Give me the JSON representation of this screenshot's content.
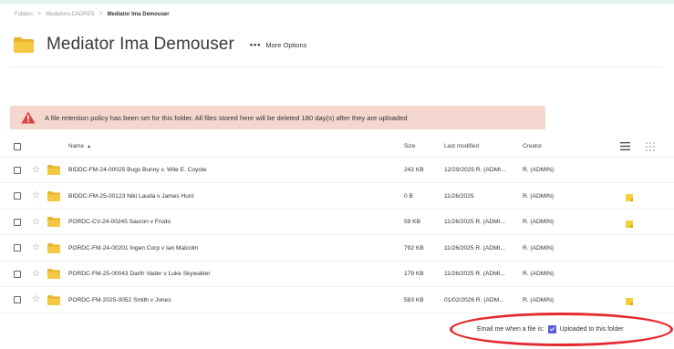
{
  "breadcrumb": {
    "items": [
      "Folders",
      "Mediators-CADRES",
      "Mediator Ima Demouser"
    ],
    "separator": ">"
  },
  "header": {
    "title": "Mediator Ima Demouser",
    "more_dots": "•••",
    "more_label": "More Options"
  },
  "banner": {
    "message": "A file retention policy has been set for this folder. All files stored here will be deleted 180 day(s) after they are uploaded",
    "color": "#f4d7cf",
    "icon": "warning-triangle-icon"
  },
  "table": {
    "columns": {
      "name": "Name",
      "sort_indicator": "▲",
      "size": "Size",
      "modified": "Last modified",
      "creator": "Creator"
    },
    "rows": [
      {
        "name": "BIDDC-FM-24-00025 Bugs Bunny v. Wile E. Coyote",
        "size": "242 KB",
        "modified": "12/29/2025 R. (ADMI...",
        "creator": "R. (ADMIN)",
        "note": false
      },
      {
        "name": "BIDDC-FM-25-00123 Niki Lauda v James Hunt",
        "size": "0 B",
        "modified": "11/26/2025",
        "creator": "R. (ADMIN)",
        "note": true
      },
      {
        "name": "PORDC-CV-24-00245 Sauron v Frodo",
        "size": "59 KB",
        "modified": "11/26/2025 R. (ADMI...",
        "creator": "R. (ADMIN)",
        "note": true
      },
      {
        "name": "PORDC-FM-24-00201 Ingen Corp v Ian Malcolm",
        "size": "792 KB",
        "modified": "11/26/2025 R. (ADMI...",
        "creator": "R. (ADMIN)",
        "note": false
      },
      {
        "name": "PORDC-FM-25-00043 Darth Vader v Luke Skywalker",
        "size": "179 KB",
        "modified": "11/26/2025 R. (ADMI...",
        "creator": "R. (ADMIN)",
        "note": false
      },
      {
        "name": "PORDC-FM-2025-0052 Smith v Jones",
        "size": "583 KB",
        "modified": "01/02/2026 R. (ADM...",
        "creator": "R. (ADMIN)",
        "note": true
      }
    ]
  },
  "email_notify": {
    "label": "Email me when a file is:",
    "option": "Uploaded to this folder",
    "checked": true
  },
  "colors": {
    "accent_check": "#5a5bd6",
    "folder": "#f2c43d",
    "highlight_oval": "#e52a2f",
    "note": "#f3d13b",
    "warning": "#d9443d"
  }
}
